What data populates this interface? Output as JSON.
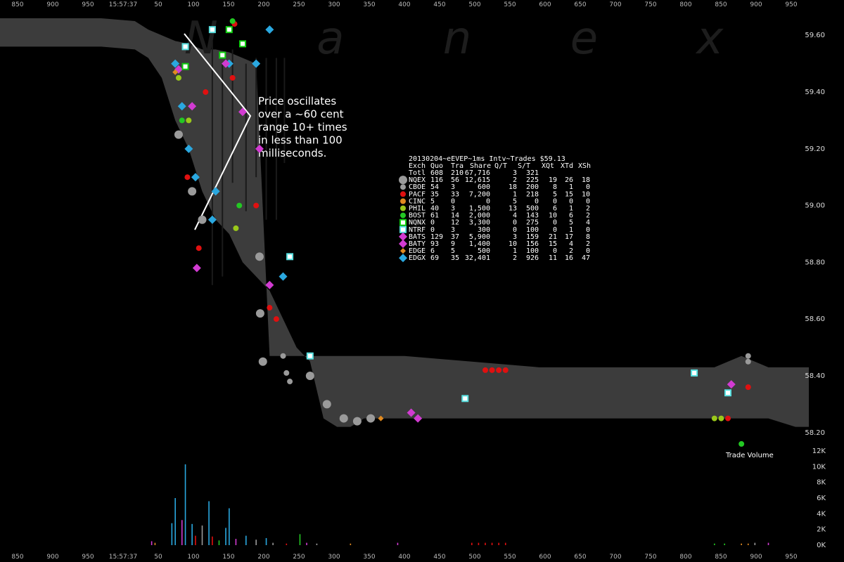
{
  "chart_data": [
    {
      "type": "scatter",
      "title": "20130204~eEVEP~1ms Intv~Trades $59.13",
      "watermark": "N a n e x",
      "x_ticks_top": [
        "850",
        "900",
        "950",
        "15:57:37",
        "50",
        "100",
        "150",
        "200",
        "250",
        "300",
        "350",
        "400",
        "450",
        "500",
        "550",
        "600",
        "650",
        "700",
        "750",
        "800",
        "850",
        "900",
        "950"
      ],
      "y_ticks": [
        "59.60",
        "59.40",
        "59.20",
        "59.00",
        "58.80",
        "58.60",
        "58.40",
        "58.20"
      ],
      "ylim": [
        58.14,
        59.66
      ],
      "xlim": [
        840,
        960
      ],
      "annotation": [
        "Price oscillates",
        "over a ~60 cent",
        "range 10+ times",
        "in less than 100",
        "milliseconds."
      ],
      "table": {
        "headers": [
          "Exch",
          "Quo",
          "Tra",
          "Share",
          "Q/T",
          "S/T",
          "XQt",
          "XTd",
          "XSh"
        ],
        "rows": [
          {
            "exch": "Totl",
            "quo": "608",
            "tra": "210",
            "share": "67,716",
            "qt": "3",
            "st": "321",
            "xqt": "",
            "xtd": "",
            "xsh": "",
            "color": "",
            "marker": "none"
          },
          {
            "exch": "NQEX",
            "quo": "116",
            "tra": "56",
            "share": "12,615",
            "qt": "2",
            "st": "225",
            "xqt": "19",
            "xtd": "26",
            "xsh": "18",
            "color": "#9a9a9a",
            "marker": "circle-lg"
          },
          {
            "exch": "CBOE",
            "quo": "54",
            "tra": "3",
            "share": "600",
            "qt": "18",
            "st": "200",
            "xqt": "8",
            "xtd": "1",
            "xsh": "0",
            "color": "#9a9a9a",
            "marker": "circle-sm"
          },
          {
            "exch": "PACF",
            "quo": "35",
            "tra": "33",
            "share": "7,200",
            "qt": "1",
            "st": "218",
            "xqt": "5",
            "xtd": "15",
            "xsh": "10",
            "color": "#e01010",
            "marker": "circle-sm"
          },
          {
            "exch": "CINC",
            "quo": "5",
            "tra": "0",
            "share": "0",
            "qt": "5",
            "st": "0",
            "xqt": "0",
            "xtd": "0",
            "xsh": "0",
            "color": "#e08a20",
            "marker": "circle-sm"
          },
          {
            "exch": "PHIL",
            "quo": "40",
            "tra": "3",
            "share": "1,500",
            "qt": "13",
            "st": "500",
            "xqt": "6",
            "xtd": "1",
            "xsh": "2",
            "color": "#9ac81a",
            "marker": "circle-sm"
          },
          {
            "exch": "BOST",
            "quo": "61",
            "tra": "14",
            "share": "2,000",
            "qt": "4",
            "st": "143",
            "xqt": "10",
            "xtd": "6",
            "xsh": "2",
            "color": "#23c823",
            "marker": "circle-sm"
          },
          {
            "exch": "NQNX",
            "quo": "0",
            "tra": "12",
            "share": "3,300",
            "qt": "0",
            "st": "275",
            "xqt": "0",
            "xtd": "5",
            "xsh": "4",
            "color": "#10d010",
            "marker": "square"
          },
          {
            "exch": "NTRF",
            "quo": "0",
            "tra": "3",
            "share": "300",
            "qt": "0",
            "st": "100",
            "xqt": "0",
            "xtd": "1",
            "xsh": "0",
            "color": "#58e0e0",
            "marker": "square"
          },
          {
            "exch": "BATS",
            "quo": "129",
            "tra": "37",
            "share": "5,900",
            "qt": "3",
            "st": "159",
            "xqt": "21",
            "xtd": "17",
            "xsh": "8",
            "color": "#d23bd2",
            "marker": "diamond"
          },
          {
            "exch": "BATY",
            "quo": "93",
            "tra": "9",
            "share": "1,400",
            "qt": "10",
            "st": "156",
            "xqt": "15",
            "xtd": "4",
            "xsh": "2",
            "color": "#d23bd2",
            "marker": "diamond"
          },
          {
            "exch": "EDGE",
            "quo": "6",
            "tra": "5",
            "share": "500",
            "qt": "1",
            "st": "100",
            "xqt": "0",
            "xtd": "2",
            "xsh": "0",
            "color": "#e08a20",
            "marker": "diamond-sm"
          },
          {
            "exch": "EDGX",
            "quo": "69",
            "tra": "35",
            "share": "32,401",
            "qt": "2",
            "st": "926",
            "xqt": "11",
            "xtd": "16",
            "xsh": "47",
            "color": "#2aa8e0",
            "marker": "diamond"
          }
        ]
      },
      "nbbo_band": {
        "x": [
          840,
          855,
          860,
          862,
          864,
          866,
          868,
          870,
          872,
          874,
          876,
          878,
          880,
          882,
          884,
          886,
          888,
          890,
          892,
          894,
          896,
          898,
          900,
          920,
          946,
          950,
          954,
          958,
          960
        ],
        "bid": [
          59.56,
          59.56,
          59.55,
          59.52,
          59.45,
          59.3,
          59.2,
          59.05,
          58.95,
          58.9,
          58.8,
          58.75,
          58.7,
          58.6,
          58.5,
          58.45,
          58.25,
          58.22,
          58.22,
          58.25,
          58.25,
          58.25,
          58.25,
          58.25,
          58.25,
          58.25,
          58.25,
          58.22,
          58.22
        ],
        "ask": [
          59.66,
          59.66,
          59.65,
          59.62,
          59.6,
          59.58,
          59.57,
          59.55,
          59.55,
          59.54,
          59.52,
          59.5,
          58.47,
          58.47,
          58.47,
          58.47,
          58.47,
          58.47,
          58.47,
          58.47,
          58.47,
          58.47,
          58.47,
          58.43,
          58.43,
          58.47,
          58.43,
          58.43,
          58.43
        ]
      },
      "trades": [
        {
          "exch": "EDGX",
          "x": 866.0,
          "y": 59.5
        },
        {
          "exch": "EDGX",
          "x": 867.0,
          "y": 59.35
        },
        {
          "exch": "EDGX",
          "x": 868.0,
          "y": 59.2
        },
        {
          "exch": "EDGX",
          "x": 869.0,
          "y": 59.1
        },
        {
          "exch": "EDGX",
          "x": 871.5,
          "y": 58.95
        },
        {
          "exch": "EDGX",
          "x": 872.0,
          "y": 59.05
        },
        {
          "exch": "EDGX",
          "x": 874.0,
          "y": 59.5
        },
        {
          "exch": "EDGX",
          "x": 878.0,
          "y": 59.5
        },
        {
          "exch": "EDGX",
          "x": 880.0,
          "y": 59.62
        },
        {
          "exch": "EDGX",
          "x": 882.0,
          "y": 58.75
        },
        {
          "exch": "NQEX",
          "x": 866.5,
          "y": 59.25
        },
        {
          "exch": "NQEX",
          "x": 868.5,
          "y": 59.05
        },
        {
          "exch": "NQEX",
          "x": 870.0,
          "y": 58.95
        },
        {
          "exch": "NQEX",
          "x": 878.5,
          "y": 58.82
        },
        {
          "exch": "NQEX",
          "x": 878.6,
          "y": 58.62
        },
        {
          "exch": "NQEX",
          "x": 879.0,
          "y": 58.45
        },
        {
          "exch": "NQEX",
          "x": 886.0,
          "y": 58.4
        },
        {
          "exch": "NQEX",
          "x": 888.5,
          "y": 58.3
        },
        {
          "exch": "NQEX",
          "x": 891.0,
          "y": 58.25
        },
        {
          "exch": "NQEX",
          "x": 893.0,
          "y": 58.24
        },
        {
          "exch": "NQEX",
          "x": 895.0,
          "y": 58.25
        },
        {
          "exch": "PACF",
          "x": 867.8,
          "y": 59.1
        },
        {
          "exch": "PACF",
          "x": 869.5,
          "y": 58.85
        },
        {
          "exch": "PACF",
          "x": 870.5,
          "y": 59.4
        },
        {
          "exch": "PACF",
          "x": 874.5,
          "y": 59.45
        },
        {
          "exch": "PACF",
          "x": 878.0,
          "y": 59.0
        },
        {
          "exch": "PACF",
          "x": 880.0,
          "y": 58.64
        },
        {
          "exch": "PACF",
          "x": 874.8,
          "y": 59.64
        },
        {
          "exch": "PACF",
          "x": 912.0,
          "y": 58.42
        },
        {
          "exch": "PACF",
          "x": 913.0,
          "y": 58.42
        },
        {
          "exch": "PACF",
          "x": 914.0,
          "y": 58.42
        },
        {
          "exch": "PACF",
          "x": 915.0,
          "y": 58.42
        },
        {
          "exch": "PACF",
          "x": 948.0,
          "y": 58.25
        },
        {
          "exch": "PACF",
          "x": 951.0,
          "y": 58.36
        },
        {
          "exch": "PACF",
          "x": 881.0,
          "y": 58.6
        },
        {
          "exch": "BATS",
          "x": 866.5,
          "y": 59.48
        },
        {
          "exch": "BATS",
          "x": 868.5,
          "y": 59.35
        },
        {
          "exch": "BATS",
          "x": 869.2,
          "y": 58.78
        },
        {
          "exch": "BATS",
          "x": 873.5,
          "y": 59.5
        },
        {
          "exch": "BATS",
          "x": 876.0,
          "y": 59.33
        },
        {
          "exch": "BATS",
          "x": 878.5,
          "y": 59.2
        },
        {
          "exch": "BATS",
          "x": 880.0,
          "y": 58.72
        },
        {
          "exch": "BATS",
          "x": 901.0,
          "y": 58.27
        },
        {
          "exch": "BATS",
          "x": 902.0,
          "y": 58.25
        },
        {
          "exch": "BATS",
          "x": 948.5,
          "y": 58.37
        },
        {
          "exch": "NQNX",
          "x": 873.0,
          "y": 59.53
        },
        {
          "exch": "NQNX",
          "x": 874.0,
          "y": 59.62
        },
        {
          "exch": "NQNX",
          "x": 876.0,
          "y": 59.57
        },
        {
          "exch": "NQNX",
          "x": 867.5,
          "y": 59.49
        },
        {
          "exch": "NTRF",
          "x": 883.0,
          "y": 58.82
        },
        {
          "exch": "NTRF",
          "x": 886.0,
          "y": 58.47
        },
        {
          "exch": "NTRF",
          "x": 867.5,
          "y": 59.56
        },
        {
          "exch": "NTRF",
          "x": 871.5,
          "y": 59.62
        },
        {
          "exch": "NTRF",
          "x": 909.0,
          "y": 58.32
        },
        {
          "exch": "NTRF",
          "x": 943.0,
          "y": 58.41
        },
        {
          "exch": "NTRF",
          "x": 948.0,
          "y": 58.34
        },
        {
          "exch": "PHIL",
          "x": 866.5,
          "y": 59.45
        },
        {
          "exch": "PHIL",
          "x": 868.0,
          "y": 59.3
        },
        {
          "exch": "PHIL",
          "x": 875.0,
          "y": 58.92
        },
        {
          "exch": "PHIL",
          "x": 946.0,
          "y": 58.25
        },
        {
          "exch": "PHIL",
          "x": 947.0,
          "y": 58.25
        },
        {
          "exch": "BOST",
          "x": 875.5,
          "y": 59.0
        },
        {
          "exch": "BOST",
          "x": 874.5,
          "y": 59.65
        },
        {
          "exch": "BOST",
          "x": 867.0,
          "y": 59.3
        },
        {
          "exch": "BOST",
          "x": 950.0,
          "y": 58.16
        },
        {
          "exch": "CBOE",
          "x": 882.0,
          "y": 58.47
        },
        {
          "exch": "CBOE",
          "x": 882.5,
          "y": 58.41
        },
        {
          "exch": "CBOE",
          "x": 883.0,
          "y": 58.38
        },
        {
          "exch": "CBOE",
          "x": 951.0,
          "y": 58.47
        },
        {
          "exch": "CBOE",
          "x": 951.0,
          "y": 58.45
        },
        {
          "exch": "EDGE",
          "x": 866.0,
          "y": 59.47
        },
        {
          "exch": "EDGE",
          "x": 896.5,
          "y": 58.25
        }
      ],
      "ref_lines_ms": [
        {
          "x": 871.5,
          "low": 58.72,
          "high": 59.58
        },
        {
          "x": 873.0,
          "low": 58.75,
          "high": 59.5
        },
        {
          "x": 874.5,
          "low": 59.08,
          "high": 59.55
        },
        {
          "x": 876.5,
          "low": 58.98,
          "high": 59.5
        },
        {
          "x": 878.0,
          "low": 59.1,
          "high": 59.52
        },
        {
          "x": 879.5,
          "low": 58.95,
          "high": 59.52
        },
        {
          "x": 881.0,
          "low": 58.95,
          "high": 59.52
        },
        {
          "x": 882.2,
          "low": 59.15,
          "high": 59.52
        }
      ]
    },
    {
      "type": "bar",
      "title": "Trade Volume",
      "y_ticks": [
        "12K",
        "10K",
        "8K",
        "6K",
        "4K",
        "2K",
        "0K"
      ],
      "ylim": [
        0,
        12000
      ],
      "x_ticks": [
        "850",
        "900",
        "950",
        "15:57:37",
        "50",
        "100",
        "150",
        "200",
        "250",
        "300",
        "350",
        "400",
        "450",
        "500",
        "550",
        "600",
        "650",
        "700",
        "750",
        "800",
        "850",
        "900",
        "950"
      ],
      "bars": [
        {
          "x": 862.5,
          "v": 500,
          "color": "#d23bd2"
        },
        {
          "x": 863.0,
          "v": 300,
          "color": "#e08a20"
        },
        {
          "x": 865.5,
          "v": 2800,
          "color": "#2aa8e0"
        },
        {
          "x": 866.0,
          "v": 6000,
          "color": "#2aa8e0"
        },
        {
          "x": 867.0,
          "v": 3200,
          "color": "#d23bd2"
        },
        {
          "x": 867.5,
          "v": 10300,
          "color": "#2aa8e0"
        },
        {
          "x": 868.5,
          "v": 2700,
          "color": "#2aa8e0"
        },
        {
          "x": 869.0,
          "v": 1200,
          "color": "#e01010"
        },
        {
          "x": 870.0,
          "v": 2500,
          "color": "#9a9a9a"
        },
        {
          "x": 871.0,
          "v": 5600,
          "color": "#2aa8e0"
        },
        {
          "x": 871.5,
          "v": 1100,
          "color": "#e01010"
        },
        {
          "x": 872.5,
          "v": 600,
          "color": "#23c823"
        },
        {
          "x": 873.5,
          "v": 2200,
          "color": "#2aa8e0"
        },
        {
          "x": 874.0,
          "v": 4700,
          "color": "#2aa8e0"
        },
        {
          "x": 875.0,
          "v": 800,
          "color": "#d23bd2"
        },
        {
          "x": 876.5,
          "v": 1200,
          "color": "#2aa8e0"
        },
        {
          "x": 878.0,
          "v": 700,
          "color": "#9a9a9a"
        },
        {
          "x": 879.5,
          "v": 900,
          "color": "#2aa8e0"
        },
        {
          "x": 880.5,
          "v": 300,
          "color": "#9a9a9a"
        },
        {
          "x": 882.5,
          "v": 200,
          "color": "#e01010"
        },
        {
          "x": 884.5,
          "v": 1400,
          "color": "#23c823"
        },
        {
          "x": 885.5,
          "v": 300,
          "color": "#d23bd2"
        },
        {
          "x": 887.0,
          "v": 200,
          "color": "#9a9a9a"
        },
        {
          "x": 892.0,
          "v": 200,
          "color": "#e08a20"
        },
        {
          "x": 899.0,
          "v": 300,
          "color": "#d23bd2"
        },
        {
          "x": 910.0,
          "v": 300,
          "color": "#e01010"
        },
        {
          "x": 911.0,
          "v": 300,
          "color": "#e01010"
        },
        {
          "x": 912.0,
          "v": 300,
          "color": "#e01010"
        },
        {
          "x": 913.0,
          "v": 300,
          "color": "#e01010"
        },
        {
          "x": 914.0,
          "v": 300,
          "color": "#e01010"
        },
        {
          "x": 915.0,
          "v": 300,
          "color": "#e01010"
        },
        {
          "x": 946.0,
          "v": 200,
          "color": "#23c823"
        },
        {
          "x": 947.5,
          "v": 200,
          "color": "#23c823"
        },
        {
          "x": 950.0,
          "v": 200,
          "color": "#e08a20"
        },
        {
          "x": 951.0,
          "v": 200,
          "color": "#e08a20"
        },
        {
          "x": 952.0,
          "v": 300,
          "color": "#9a9a9a"
        },
        {
          "x": 954.0,
          "v": 300,
          "color": "#d23bd2"
        }
      ]
    }
  ]
}
